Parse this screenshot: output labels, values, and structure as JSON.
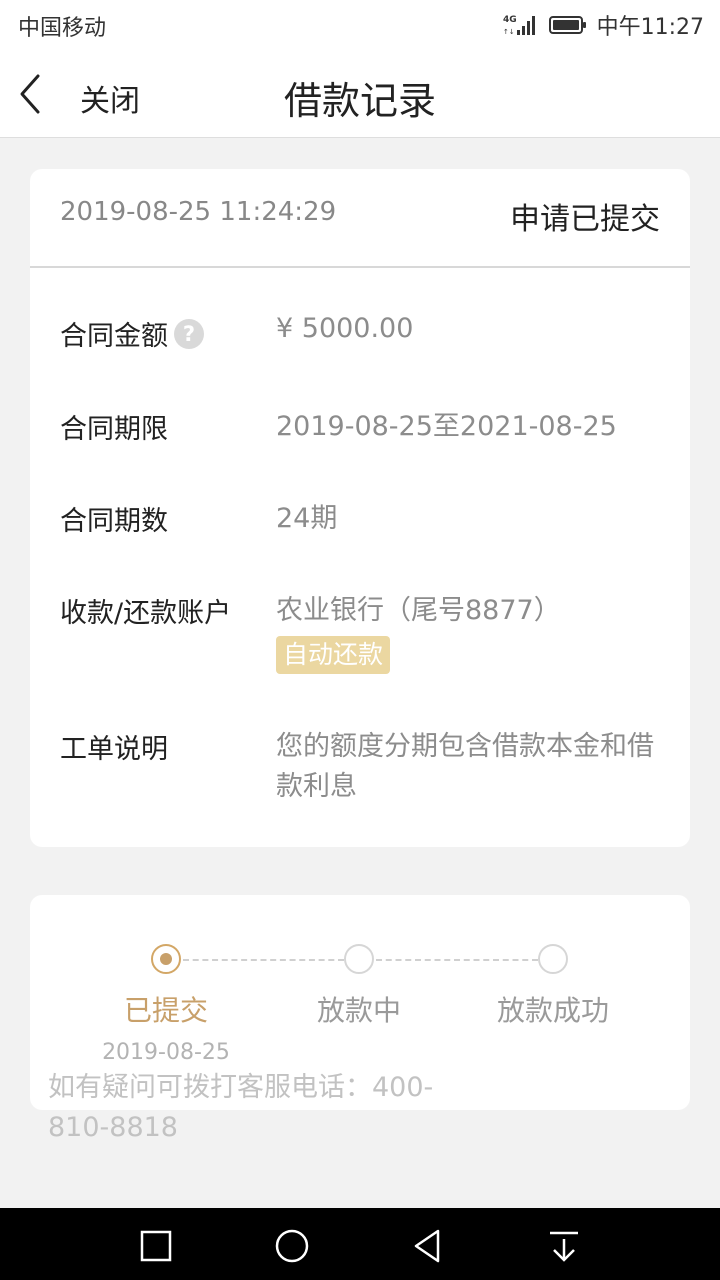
{
  "status_bar": {
    "carrier": "中国移动",
    "network": "4G",
    "time": "中午11:27",
    "icons": [
      "signal-icon",
      "battery-icon"
    ]
  },
  "nav": {
    "close_label": "关闭",
    "title": "借款记录"
  },
  "record": {
    "submit_time": "2019-08-25 11:24:29",
    "status": "申请已提交",
    "rows": [
      {
        "label": "合同金额",
        "value": "¥ 5000.00"
      },
      {
        "label": "合同期限",
        "value": "2019-08-25至2021-08-25"
      },
      {
        "label": "合同期数",
        "value": "24期"
      },
      {
        "label": "收款/还款账户",
        "value": "农业银行（尾号8877）"
      },
      {
        "label": "工单说明",
        "value": "您的额度分期包含借款本金和借款利息"
      }
    ],
    "help_glyph": "?",
    "auto_repay_badge": "自动还款"
  },
  "progress": {
    "steps": [
      {
        "label": "已提交",
        "date": "2019-08-25",
        "active": true
      },
      {
        "label": "放款中",
        "active": false
      },
      {
        "label": "放款成功",
        "active": false
      }
    ]
  },
  "service": {
    "text": "如有疑问可拨打客服电话：400-810-8818"
  },
  "colors": {
    "accent": "#c8a06a",
    "badge_bg": "#ebd7a1",
    "background": "#f2f2f2"
  }
}
